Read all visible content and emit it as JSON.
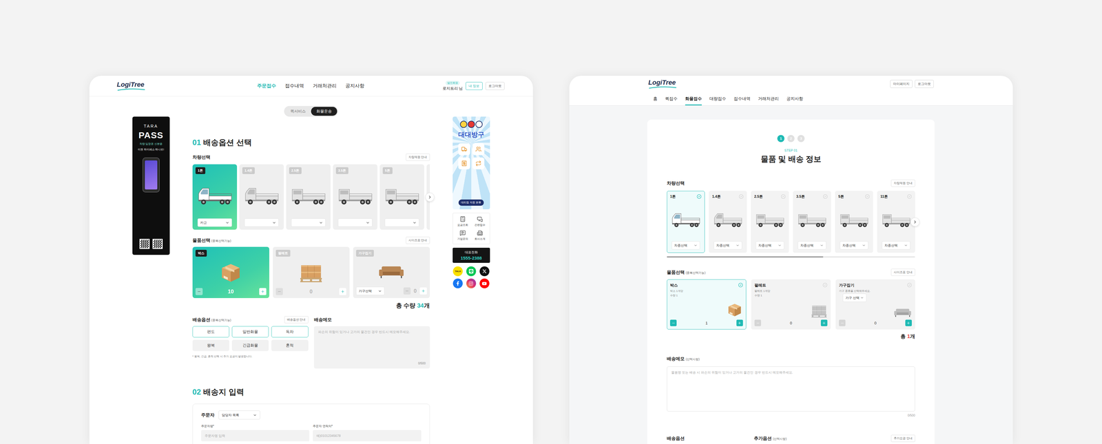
{
  "left_screen": {
    "header": {
      "logo": "LogiTree",
      "nav": [
        {
          "label": "주문접수",
          "selected": true
        },
        {
          "label": "접수내역",
          "selected": false
        },
        {
          "label": "거래처관리",
          "selected": false
        },
        {
          "label": "공지사항",
          "selected": false
        }
      ],
      "member_badge": "법인회원",
      "user": "로지트리 님",
      "buttons": [
        "내 정보",
        "로그아웃"
      ]
    },
    "service_tabs": [
      {
        "label": "퀵서비스",
        "selected": false
      },
      {
        "label": "화물운송",
        "selected": true
      }
    ],
    "left_banner": {
      "title": "TARA",
      "headline": "PASS",
      "lines": [
        "차량 입장권 신분증",
        "이젠 하이패스 하나로!"
      ]
    },
    "option_section": {
      "number": "01",
      "title": "배송옵션 선택"
    },
    "vehicle": {
      "label": "차량선택",
      "guide": "차량제원 안내",
      "items": [
        {
          "tonnage": "1톤",
          "type": "카고",
          "selected": true
        },
        {
          "tonnage": "1.4톤",
          "type": "",
          "selected": false
        },
        {
          "tonnage": "2.5톤",
          "type": "",
          "selected": false
        },
        {
          "tonnage": "3.5톤",
          "type": "",
          "selected": false
        },
        {
          "tonnage": "5톤",
          "type": "",
          "selected": false
        },
        {
          "tonnage": "",
          "type": "",
          "selected": false
        }
      ]
    },
    "goods": {
      "label": "물품선택",
      "hint": "(중복선택가능)",
      "guide": "사이즈표 안내",
      "items": [
        {
          "name": "박스",
          "kind": "box",
          "count": "10",
          "selected": true
        },
        {
          "name": "팔레트",
          "kind": "pallet",
          "count": "0",
          "selected": false
        },
        {
          "name": "가구집기",
          "kind": "furniture",
          "select": "가구선택",
          "count": "0",
          "selected": false
        }
      ],
      "total": {
        "label": "총 수량",
        "value": "34",
        "unit": "개"
      }
    },
    "delivery_options": {
      "label": "배송옵션",
      "hint": "(중복선택가능)",
      "guide": "배송옵션 안내",
      "items": [
        {
          "label": "편도",
          "selected": true
        },
        {
          "label": "일반화물",
          "selected": true
        },
        {
          "label": "독차",
          "selected": true
        },
        {
          "label": "왕복",
          "selected": false
        },
        {
          "label": "긴급화물",
          "selected": false
        },
        {
          "label": "혼적",
          "selected": false
        }
      ],
      "note": "* 왕복, 긴급, 혼적 선택 시 추가 요금이 발생합니다."
    },
    "memo": {
      "label": "배송메모",
      "placeholder": "파손의 위험이 있거나 고가의 물건인 경우 반드시 메모해주세요.",
      "counter": "0/500"
    },
    "address_section": {
      "number": "02",
      "title": "배송지 입력",
      "orderer_label": "주문자",
      "manager_select": "담당자 목록",
      "fields": [
        {
          "label": "주문자명*",
          "placeholder": "주문자명 입력"
        },
        {
          "label": "주문자 연락처*",
          "placeholder": "예)01012345678"
        }
      ]
    },
    "right_banner": {
      "title": "대대방구",
      "pill": "대리점 자동 분류"
    },
    "quick_menu": [
      "요금조회",
      "간편접수",
      "기업문의",
      "회사소개"
    ],
    "phone": {
      "label": "대표전화",
      "number": "1555-2388"
    },
    "social": {
      "kakao_label": "TALK"
    }
  },
  "right_screen": {
    "header": {
      "logo": "LogiTree",
      "buttons": [
        "마이페이지",
        "로그아웃"
      ],
      "nav": [
        {
          "label": "홈",
          "selected": false
        },
        {
          "label": "퀵접수",
          "selected": false
        },
        {
          "label": "화물접수",
          "selected": true
        },
        {
          "label": "대량접수",
          "selected": false
        },
        {
          "label": "접수내역",
          "selected": false
        },
        {
          "label": "거래처관리",
          "selected": false
        },
        {
          "label": "공지사항",
          "selected": false
        }
      ]
    },
    "steps": [
      {
        "label": "1",
        "selected": true
      },
      {
        "label": "2",
        "selected": false
      },
      {
        "label": "3",
        "selected": false
      }
    ],
    "step_caption": "STEP 01",
    "title": "물품 및 배송 정보",
    "vehicle": {
      "label": "차량선택",
      "guide": "차량제원 안내",
      "items": [
        {
          "tonnage": "1톤",
          "select": "차종선택",
          "selected": true
        },
        {
          "tonnage": "1.4톤",
          "select": "차종선택",
          "selected": false
        },
        {
          "tonnage": "2.5톤",
          "select": "차종선택",
          "selected": false
        },
        {
          "tonnage": "3.5톤",
          "select": "차종선택",
          "selected": false
        },
        {
          "tonnage": "5톤",
          "select": "차종선택",
          "selected": false
        },
        {
          "tonnage": "11톤",
          "select": "차종선택",
          "selected": false
        }
      ],
      "scroll": {
        "level": 0.63
      }
    },
    "goods": {
      "label": "물품선택",
      "hint": "(중복선택가능)",
      "guide": "사이즈표 안내",
      "items": [
        {
          "name": "박스",
          "kind": "box",
          "desc": [
            "박스 1개당",
            "수량 1"
          ],
          "count": "1",
          "selected": true
        },
        {
          "name": "팔레트",
          "kind": "pallet",
          "desc": [
            "팔레트 1개당",
            "수량 1"
          ],
          "count": "0",
          "selected": false
        },
        {
          "name": "가구집기",
          "kind": "furniture",
          "desc": [
            "가구 종류를 선택해주세요."
          ],
          "select": "가구 선택",
          "count": "0",
          "selected": false
        }
      ],
      "total": {
        "label": "총",
        "value": "1",
        "unit": "개"
      }
    },
    "memo": {
      "label": "배송메모",
      "hint": "(선택사항)",
      "placeholder": "물품명 또는 배송 시 파손의 위험이 있거나 고가의 물건인 경우 반드시 메모해주세요.",
      "counter": "0/500"
    },
    "bottom": {
      "options_label": "배송옵션",
      "extra_label": "추가옵션",
      "extra_hint": "(선택사항)",
      "guide": "추가요금 안내"
    }
  }
}
